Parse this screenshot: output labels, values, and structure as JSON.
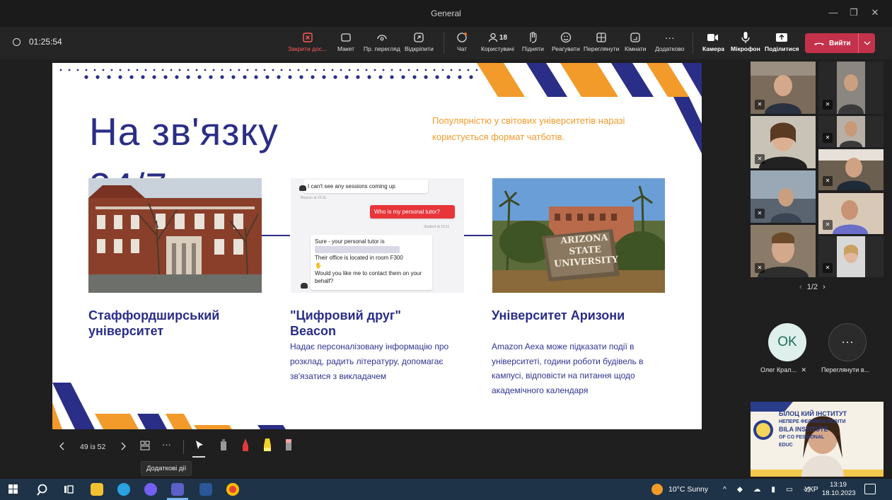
{
  "window": {
    "title": "General",
    "controls": [
      "—",
      "❐",
      "✕"
    ]
  },
  "toolbar": {
    "timer": "01:25:54",
    "buttons": [
      {
        "label": "Закрити дос...",
        "icon": "close-share-icon"
      },
      {
        "label": "Макет",
        "icon": "layout-icon"
      },
      {
        "label": "Пр. перегляд",
        "icon": "eye-icon"
      },
      {
        "label": "Відкріпити",
        "icon": "popout-icon"
      },
      {
        "label": "Чат",
        "icon": "chat-icon"
      },
      {
        "label": "Користувачі",
        "icon": "people-icon",
        "count": "18"
      },
      {
        "label": "Підняти",
        "icon": "hand-icon"
      },
      {
        "label": "Реагувати",
        "icon": "smile-icon"
      },
      {
        "label": "Переглянути",
        "icon": "view-icon"
      },
      {
        "label": "Кімнати",
        "icon": "rooms-icon"
      },
      {
        "label": "Додатково",
        "icon": "more-icon"
      },
      {
        "label": "Камера",
        "icon": "camera-icon"
      },
      {
        "label": "Мікрофон",
        "icon": "mic-icon"
      },
      {
        "label": "Поділитися",
        "icon": "share-icon"
      }
    ],
    "leave_label": "Вийти"
  },
  "slide": {
    "title": "На зв'язку 24/7",
    "lead": "Популярністю у світових університетів наразі користується формат чатботів.",
    "columns": [
      {
        "heading": "Стаффордширський університет",
        "body": ""
      },
      {
        "heading": "\"Цифровий друг\" Beacon",
        "body": "Надає персоналізовану інформацію про розклад, радить літературу, допомагає зв'язатися з викладачем"
      },
      {
        "heading": "Університет Аризони",
        "body": "Amazon Aexa може підказати події в університеті, години роботи будівель в кампусі, відповісти на питання щодо академічного календаря"
      }
    ],
    "chat": {
      "msg1": "I can't see any sessions coming up",
      "msg1_meta": "Beacon at 10:11",
      "msg2": "Who is my personal tutor?",
      "msg2_meta": "Student at 10:11",
      "msg3a": "Sure - your personal tutor is",
      "msg3b": "Their office is located in room F300",
      "msg3c": "Would you like me to contact them on your behalf?"
    },
    "sign_text": "ARIZONA STATE UNIVERSITY"
  },
  "slide_controls": {
    "page": "49 із 52",
    "tooltip": "Додаткові дії"
  },
  "participants": {
    "pager": "1/2",
    "avatar1": {
      "initials": "OK",
      "name": "Олег Крал..."
    },
    "avatar2": {
      "label": "Переглянути в..."
    }
  },
  "banner": {
    "line1": "БІЛОЦ    КИЙ ІНСТИТУТ",
    "line2": "НЕПЕРЕ     ФЕСІЙНОЇ ОСВІТИ",
    "line3": "BILA       INSTITUTE",
    "line4": "OF CO      FESSIONAL",
    "line5": "EDUC"
  },
  "taskbar": {
    "weather": "10°C  Sunny",
    "lang": "УКР",
    "time": "13:19",
    "date": "18.10.2023"
  }
}
